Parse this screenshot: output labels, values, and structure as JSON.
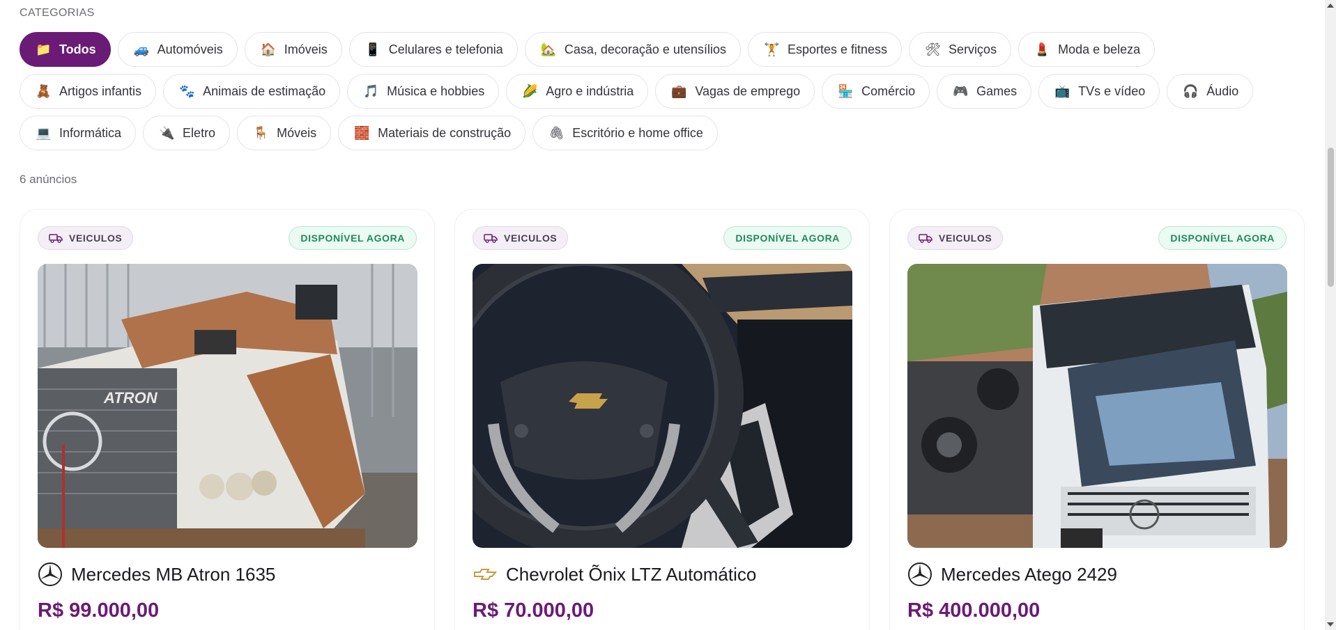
{
  "categories": {
    "title": "CATEGORIAS",
    "row1": [
      {
        "label": "Todos",
        "icon": "📁",
        "active": true
      },
      {
        "label": "Automóveis",
        "icon": "🚙"
      },
      {
        "label": "Imóveis",
        "icon": "🏠"
      },
      {
        "label": "Celulares e telefonia",
        "icon": "📱"
      },
      {
        "label": "Casa, decoração e utensílios",
        "icon": "🏡"
      },
      {
        "label": "Esportes e fitness",
        "icon": "🏋"
      },
      {
        "label": "Serviços",
        "icon": "🛠"
      },
      {
        "label": "Moda e beleza",
        "icon": "💄"
      }
    ],
    "row2": [
      {
        "label": "Artigos infantis",
        "icon": "🧸"
      },
      {
        "label": "Animais de estimação",
        "icon": "🐾"
      },
      {
        "label": "Música e hobbies",
        "icon": "🎵"
      },
      {
        "label": "Agro e indústria",
        "icon": "🌽"
      },
      {
        "label": "Vagas de emprego",
        "icon": "💼"
      },
      {
        "label": "Comércio",
        "icon": "🏪"
      },
      {
        "label": "Games",
        "icon": "🎮"
      },
      {
        "label": "TVs e vídeo",
        "icon": "📺"
      },
      {
        "label": "Áudio",
        "icon": "🎧"
      }
    ],
    "row3": [
      {
        "label": "Informática",
        "icon": "💻"
      },
      {
        "label": "Eletro",
        "icon": "🔌"
      },
      {
        "label": "Móveis",
        "icon": "🪑"
      },
      {
        "label": "Materiais de construção",
        "icon": "🧱"
      },
      {
        "label": "Escritório e home office",
        "icon": "🖇"
      }
    ]
  },
  "listing_count": "6 anúncios",
  "listings": [
    {
      "category": "VEICULOS",
      "status": "DISPONÍVEL AGORA",
      "brand_icon": "mercedes-logo-icon",
      "title": "Mercedes MB Atron 1635",
      "price": "R$ 99.000,00"
    },
    {
      "category": "VEICULOS",
      "status": "DISPONÍVEL AGORA",
      "brand_icon": "chevrolet-logo-icon",
      "title": "Chevrolet Õnix LTZ Automático",
      "price": "R$ 70.000,00"
    },
    {
      "category": "VEICULOS",
      "status": "DISPONÍVEL AGORA",
      "brand_icon": "mercedes-logo-icon",
      "title": "Mercedes Atego 2429",
      "price": "R$ 400.000,00"
    }
  ],
  "colors": {
    "brand": "#6a1b76",
    "available": "#1f8a5b"
  }
}
